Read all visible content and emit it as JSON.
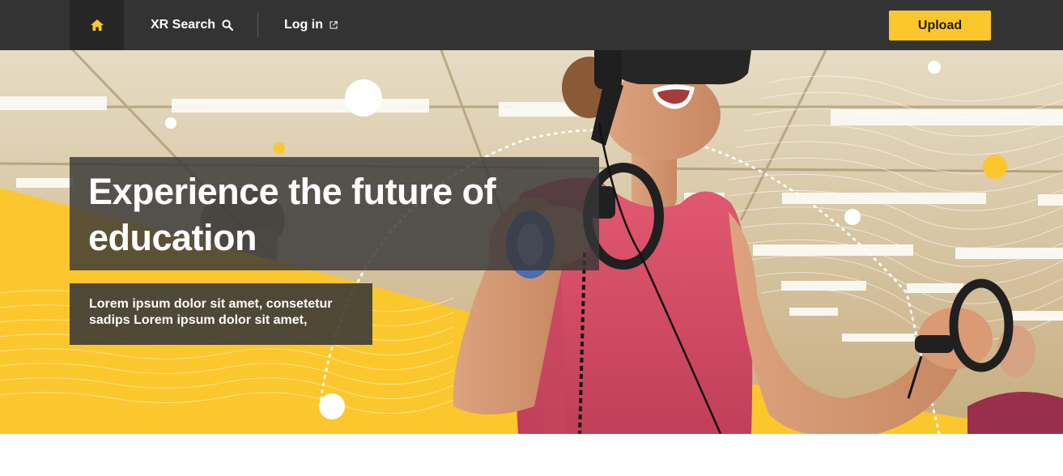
{
  "nav": {
    "home_icon": "home-icon",
    "search_label": "XR Search",
    "search_icon": "search-icon",
    "login_label": "Log in",
    "login_icon": "external-link-icon",
    "upload_label": "Upload"
  },
  "hero": {
    "headline": "Experience the future of education",
    "subtitle": "Lorem ipsum dolor sit amet, consetetur sadips Lorem ipsum dolor sit amet,",
    "image_description": "hero-photo-vr-headset-user"
  },
  "colors": {
    "topbar": "#333333",
    "home_active": "#262626",
    "accent_yellow": "#fcc72d",
    "overlay_dark": "#373737",
    "text_white": "#ffffff"
  }
}
